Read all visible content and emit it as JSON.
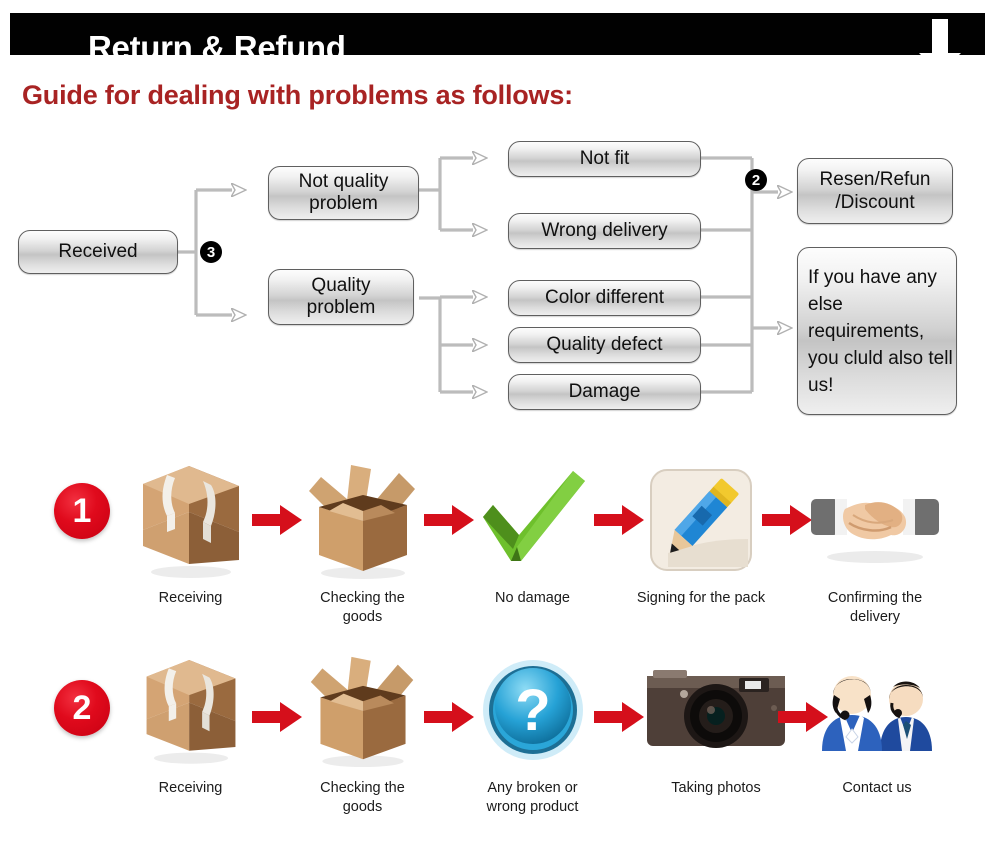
{
  "header": {
    "title": "Return & Refund",
    "arrow_icon": "down-arrow-icon"
  },
  "guide": {
    "heading": "Guide for dealing with problems as follows:"
  },
  "flowchart": {
    "markers": [
      {
        "label": "3",
        "name": "flow-marker-3"
      },
      {
        "label": "2",
        "name": "flow-marker-2"
      }
    ],
    "nodes": {
      "received": "Received",
      "not_quality_problem": "Not quality\nproblem",
      "quality_problem": "Quality\nproblem",
      "not_fit": "Not fit",
      "wrong_delivery": "Wrong delivery",
      "color_different": "Color different",
      "quality_defect": "Quality defect",
      "damage": "Damage",
      "resend_refund": "Resen/Refun\n/Discount",
      "any_else": "If you have any else requirements, you cluld also tell us!"
    }
  },
  "steps": {
    "row1": {
      "badge": "1",
      "items": [
        {
          "icon": "sealed-box-icon",
          "caption": "Receiving"
        },
        {
          "icon": "open-box-icon",
          "caption": "Checking the goods"
        },
        {
          "icon": "green-check-icon",
          "caption": "No damage"
        },
        {
          "icon": "pencil-signing-icon",
          "caption": "Signing for the pack"
        },
        {
          "icon": "handshake-icon",
          "caption": "Confirming the delivery"
        }
      ],
      "arrow_icon": "red-right-arrow-icon"
    },
    "row2": {
      "badge": "2",
      "items": [
        {
          "icon": "sealed-box-icon",
          "caption": "Receiving"
        },
        {
          "icon": "open-box-icon",
          "caption": "Checking the goods"
        },
        {
          "icon": "blue-question-icon",
          "caption": "Any broken or wrong product"
        },
        {
          "icon": "camera-icon",
          "caption": "Taking photos"
        },
        {
          "icon": "support-agents-icon",
          "caption": "Contact us"
        }
      ],
      "arrow_icon": "red-right-arrow-icon"
    }
  },
  "colors": {
    "header_bg": "#010101",
    "heading_red": "#a82323",
    "badge_red": "#dd0a1c",
    "arrow_red": "#d50f1b",
    "box_border": "#5f5f5f",
    "connector_gray": "#b9b9b9"
  }
}
